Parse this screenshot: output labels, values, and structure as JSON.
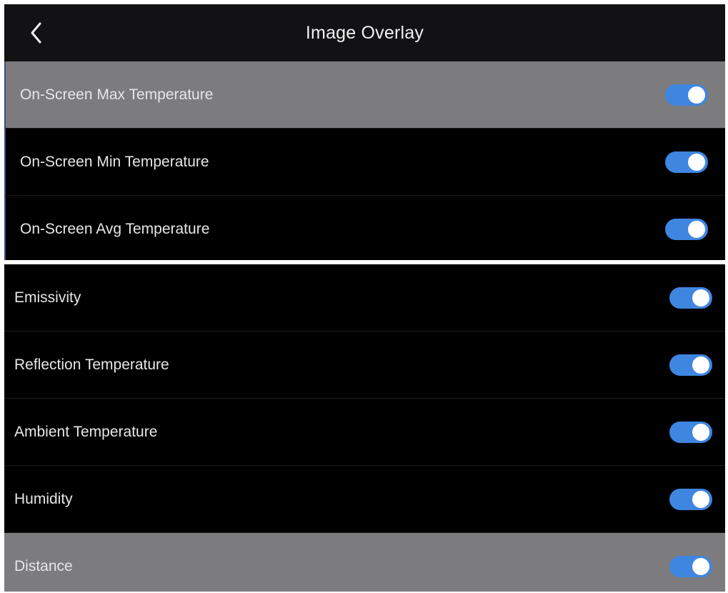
{
  "header": {
    "title": "Image Overlay",
    "back_icon": "chevron-left-icon"
  },
  "colors": {
    "accent": "#3f86e0",
    "highlight_row": "#7c7c7e",
    "background": "#000000"
  },
  "settings": [
    {
      "label": "On-Screen Max Temperature",
      "enabled": true,
      "highlighted": true
    },
    {
      "label": "On-Screen Min Temperature",
      "enabled": true,
      "highlighted": false
    },
    {
      "label": "On-Screen Avg Temperature",
      "enabled": true,
      "highlighted": false
    },
    {
      "label": "Emissivity",
      "enabled": true,
      "highlighted": false
    },
    {
      "label": "Reflection Temperature",
      "enabled": true,
      "highlighted": false
    },
    {
      "label": "Ambient Temperature",
      "enabled": true,
      "highlighted": false
    },
    {
      "label": "Humidity",
      "enabled": true,
      "highlighted": false
    },
    {
      "label": "Distance",
      "enabled": true,
      "highlighted": true
    }
  ]
}
